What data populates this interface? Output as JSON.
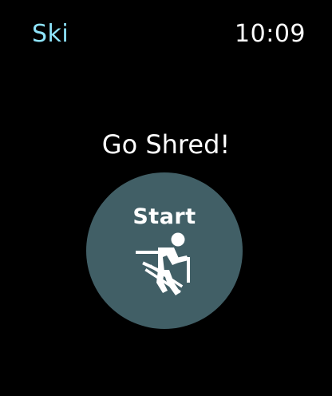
{
  "header": {
    "app_title": "Ski",
    "time": "10:09"
  },
  "main": {
    "headline": "Go Shred!",
    "start_button": {
      "label": "Start",
      "icon": "skier-icon"
    }
  },
  "colors": {
    "background": "#000000",
    "accent": "#8ee4fb",
    "button_fill": "#415f66",
    "text": "#ffffff"
  }
}
